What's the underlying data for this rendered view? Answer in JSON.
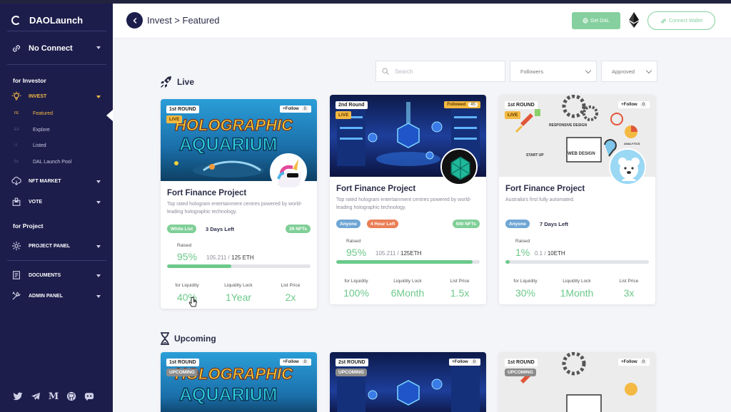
{
  "app": {
    "name": "DAOLaunch"
  },
  "sidebar": {
    "wallet_label": "No Connect",
    "investor_title": "for Investor",
    "invest_label": "INVEST",
    "invest_sub": [
      {
        "abbr": "FE",
        "label": "Featured"
      },
      {
        "abbr": "EX",
        "label": "Explore"
      },
      {
        "abbr": "LI",
        "label": "Listed"
      },
      {
        "abbr": "DL",
        "label": "DAL Launch Pool"
      }
    ],
    "nft_label": "NFT MARKET",
    "vote_label": "VOTE",
    "project_title": "for Project",
    "project_panel_label": "PROJECT PANEL",
    "documents_label": "DOCUMENTS",
    "admin_label": "ADMIN PANEL",
    "socials": [
      "twitter-icon",
      "telegram-icon",
      "medium-icon",
      "github-icon",
      "discord-icon"
    ]
  },
  "header": {
    "breadcrumb": "Invest > Featured",
    "get_dal": "Get DAL",
    "connect_wallet": "Connect Wallet"
  },
  "filters": {
    "search_placeholder": "Search",
    "sort_value": "Followers",
    "status_value": "Approved"
  },
  "sections": {
    "live": "Live",
    "upcoming": "Upcoming"
  },
  "colors": {
    "accent_green": "#6cc98a",
    "sidebar_bg": "#1c1d4b",
    "live_badge": "#f4b942"
  },
  "live_cards": [
    {
      "round": "1st ROUND",
      "status": "LIVE",
      "follow": "+Follow",
      "follow_count": "0",
      "banner_text_1": "HOLOGRAPHIC",
      "banner_text_2": "AQUARIUM",
      "title": "Fort Finance Project",
      "desc": "Top rated hologram entertainment centres powered by world-leading holographic technology.",
      "chip": "White List",
      "days": "3 Days Left",
      "nfts": "29 NFTs",
      "raised_label": "Raised",
      "raised_pct": "95%",
      "raised_amount": "105.211 /",
      "raised_total": "125 ETH",
      "progress": 0.45,
      "stats": [
        {
          "label": "for Liquidity",
          "value": "40%"
        },
        {
          "label": "Liquidity Lock",
          "value": "1Year"
        },
        {
          "label": "List Price",
          "value": "2x"
        }
      ]
    },
    {
      "round": "2nd Round",
      "status": "LIVE",
      "follow": "Followed",
      "follow_count": "45",
      "title": "Fort Finance Project",
      "desc": "Top rated hologram entertainment centres powered by world-leading holographic technology.",
      "chip": "Anyone",
      "chip2": "4 Hour Left",
      "nfts": "500 NFTs",
      "raised_label": "Raised",
      "raised_pct": "95%",
      "raised_amount": "105.211 /",
      "raised_total": "125ETH",
      "progress": 0.95,
      "stats": [
        {
          "label": "for Liquidity",
          "value": "100%"
        },
        {
          "label": "Liquidity Lock",
          "value": "6Month"
        },
        {
          "label": "List Price",
          "value": "1.5x"
        }
      ]
    },
    {
      "round": "1st ROUND",
      "status": "LIVE",
      "follow": "+Follow",
      "follow_count": "0",
      "banner_text_1": "RESPONSIVE DESIGN",
      "banner_text_2": "WEB DESIGN",
      "banner_text_3": "START UP",
      "banner_text_4": "ANALYTICS",
      "title": "Fort Finance Project",
      "desc": "Australia's first fully automated.",
      "chip": "Anyone",
      "days": "7 Days Left",
      "raised_label": "Raised",
      "raised_pct": "1%",
      "raised_amount": "0.1 /",
      "raised_total": "10ETH",
      "progress": 0.01,
      "stats": [
        {
          "label": "for Liquidity",
          "value": "30%"
        },
        {
          "label": "Liquidity Lock",
          "value": "1Month"
        },
        {
          "label": "List Price",
          "value": "3x"
        }
      ]
    }
  ],
  "upcoming_cards": [
    {
      "round": "1st ROUND",
      "status": "UPCOMING",
      "follow": "+Follow",
      "follow_count": "0",
      "banner_text_1": "HOLOGRAPHIC",
      "banner_text_2": "AQUARIUM"
    },
    {
      "round": "2st ROUND",
      "status": "UPCOMING",
      "follow": "+Follow",
      "follow_count": "0"
    },
    {
      "round": "1st ROUND",
      "status": "UPCOMING",
      "follow": "+Follow",
      "follow_count": "0"
    }
  ]
}
